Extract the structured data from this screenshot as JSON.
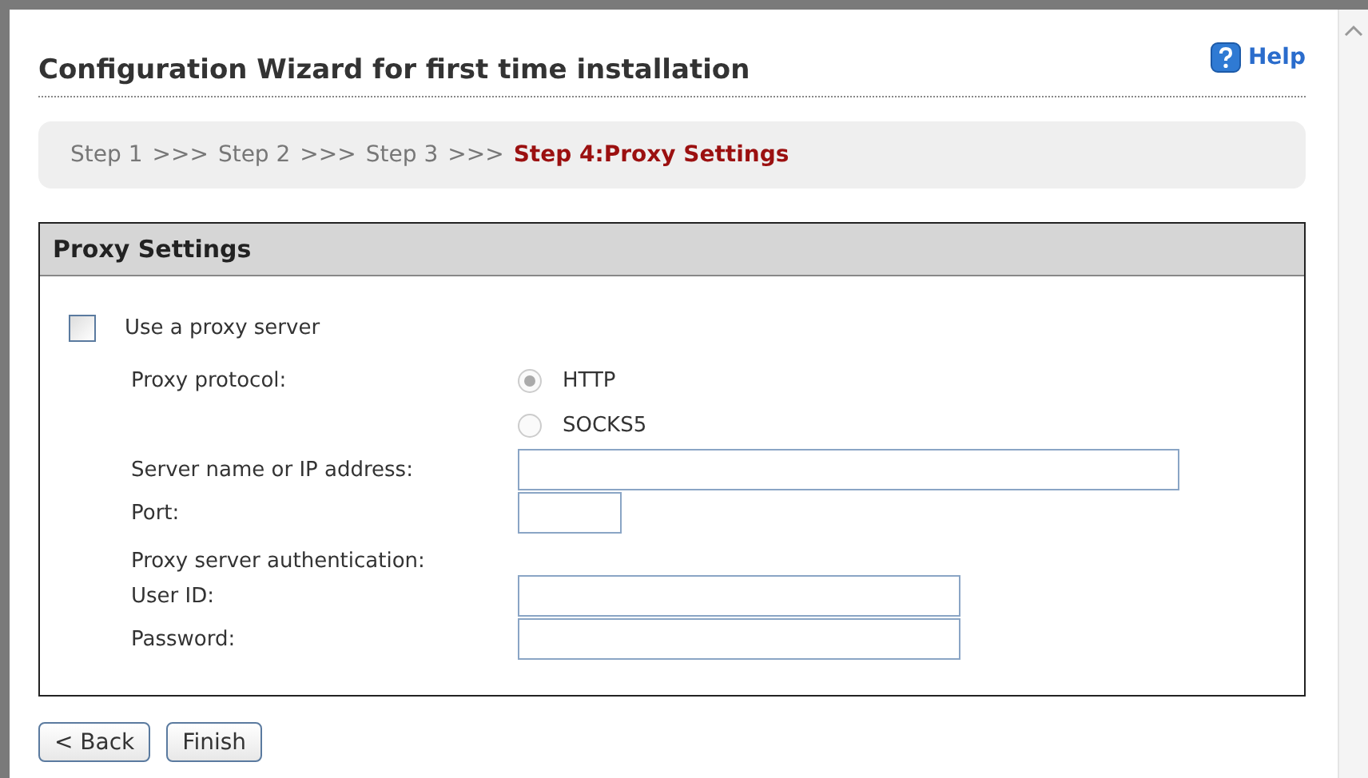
{
  "title": "Configuration Wizard for first time installation",
  "help": "Help",
  "steps": [
    {
      "label": "Step 1",
      "current": false,
      "separator": ">>>"
    },
    {
      "label": "Step 2",
      "current": false,
      "separator": ">>>"
    },
    {
      "label": "Step 3",
      "current": false,
      "separator": ">>>"
    },
    {
      "label": "Step 4:Proxy Settings",
      "current": true
    }
  ],
  "panel": {
    "title": "Proxy Settings",
    "use_proxy": {
      "label": "Use a proxy server",
      "checked": false
    },
    "protocol": {
      "label": "Proxy protocol:",
      "disabled": true,
      "options": [
        {
          "label": "HTTP",
          "selected": true
        },
        {
          "label": "SOCKS5",
          "selected": false
        }
      ]
    },
    "server": {
      "label": "Server name or IP address:"
    },
    "port": {
      "label": "Port:"
    },
    "auth_heading": "Proxy server authentication:",
    "user_id": {
      "label": "User ID:"
    },
    "password": {
      "label": "Password:"
    }
  },
  "buttons": [
    "< Back",
    "Finish"
  ]
}
